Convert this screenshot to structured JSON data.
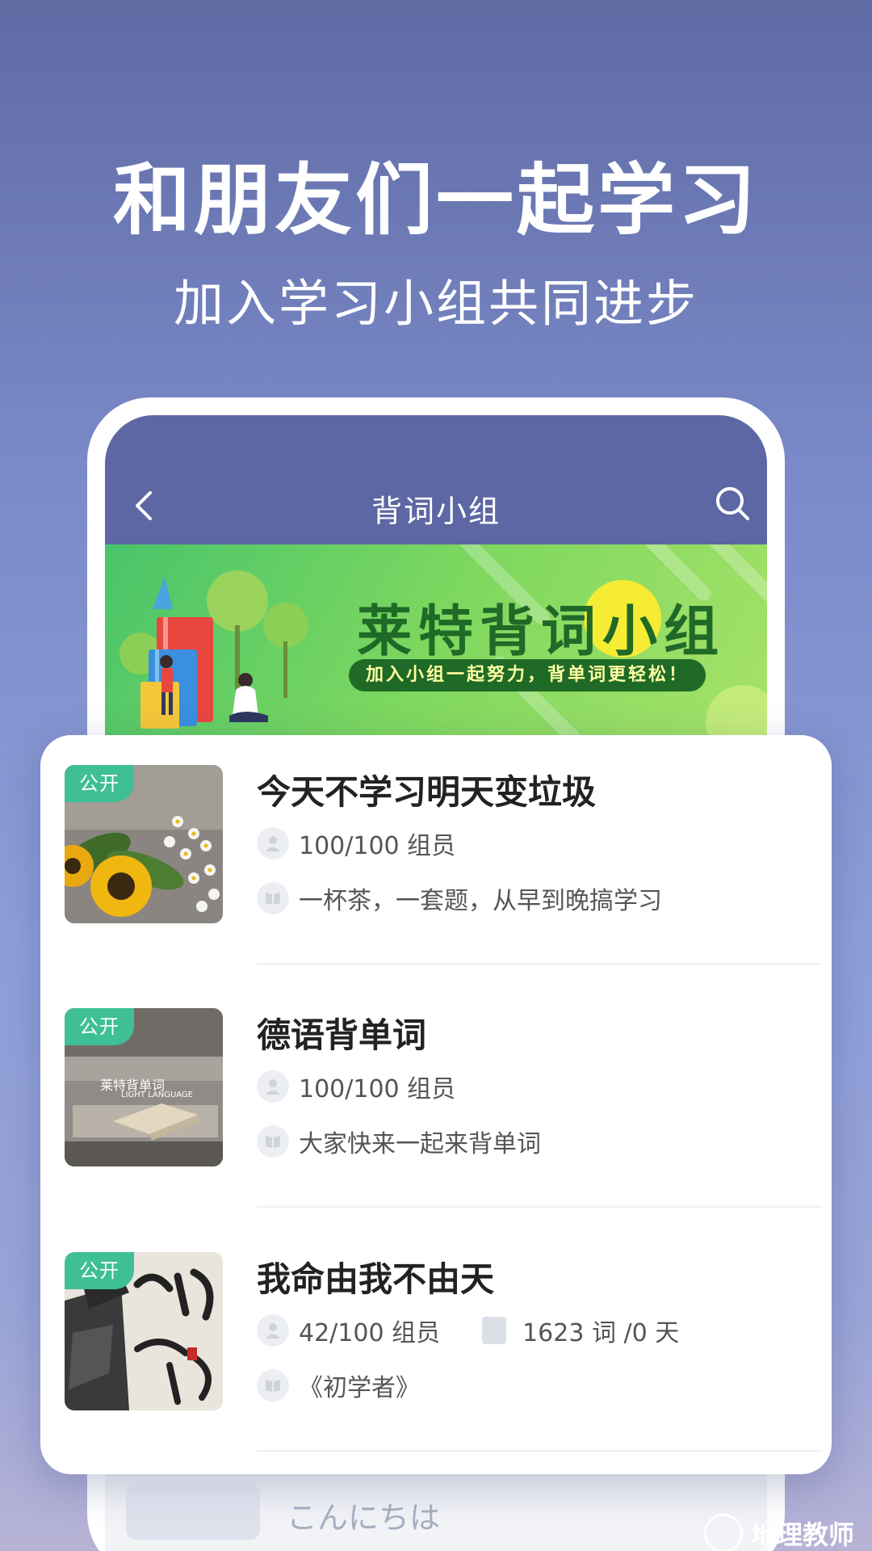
{
  "headline": "和朋友们一起学习",
  "subheadline": "加入学习小组共同进步",
  "app": {
    "nav_title": "背词小组",
    "back_icon": "chevron-left-icon",
    "search_icon": "search-icon"
  },
  "banner": {
    "title_main": "莱特背词",
    "title_highlight": "小组",
    "slogan": "加入小组一起努力，背单词更轻松！"
  },
  "groups": [
    {
      "tag": "公开",
      "title": "今天不学习明天变垃圾",
      "members": "100/100 组员",
      "description": "一杯茶，一套题，从早到晚搞学习"
    },
    {
      "tag": "公开",
      "title": "德语背单词",
      "members": "100/100 组员",
      "description": "大家快来一起来背单词",
      "thumb_caption": "莱特背单词",
      "thumb_caption_sub": "LIGHT LANGUAGE"
    },
    {
      "tag": "公开",
      "title": "我命由我不由天",
      "members": "42/100 组员",
      "progress": "1623 词 /0 天",
      "description": "《初学者》"
    }
  ],
  "faded_item": {
    "title": "こんにちは"
  },
  "watermark": "地理教师",
  "colors": {
    "accent": "#5c67a3",
    "tag_green": "#3fbf96",
    "banner_green": "#1f6a27"
  }
}
